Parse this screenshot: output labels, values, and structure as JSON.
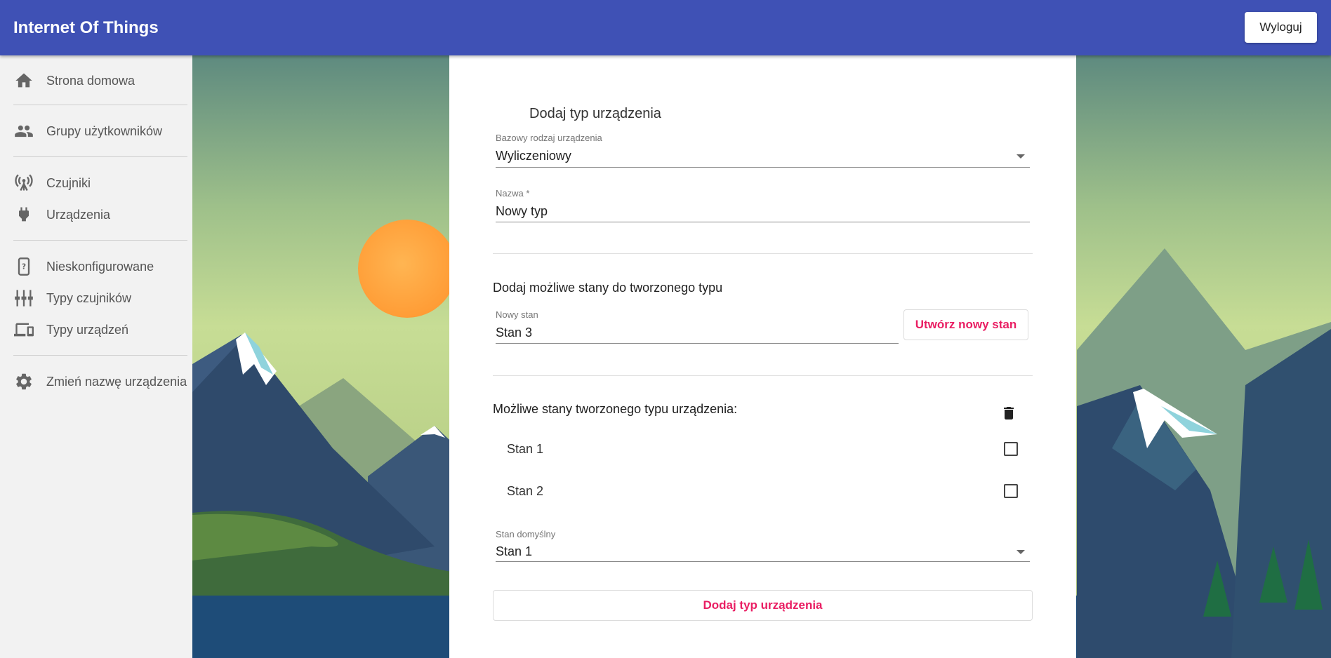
{
  "header": {
    "title": "Internet Of Things",
    "logout_label": "Wyloguj"
  },
  "sidebar": {
    "items": [
      {
        "label": "Strona domowa",
        "icon": "home-icon"
      },
      {
        "label": "Grupy użytkowników",
        "icon": "people-icon"
      },
      {
        "label": "Czujniki",
        "icon": "antenna-icon"
      },
      {
        "label": "Urządzenia",
        "icon": "plug-icon"
      },
      {
        "label": "Nieskonfigurowane",
        "icon": "unknown-device-icon"
      },
      {
        "label": "Typy czujników",
        "icon": "sliders-icon"
      },
      {
        "label": "Typy urządzeń",
        "icon": "devices-icon"
      },
      {
        "label": "Zmień nazwę urządzenia",
        "icon": "gear-icon"
      }
    ]
  },
  "form": {
    "title": "Dodaj typ urządzenia",
    "base_type": {
      "label": "Bazowy rodzaj urządzenia",
      "value": "Wyliczeniowy"
    },
    "name": {
      "label": "Nazwa *",
      "value": "Nowy typ"
    },
    "states_heading": "Dodaj możliwe stany do tworzonego typu",
    "new_state": {
      "label": "Nowy stan",
      "value": "Stan 3"
    },
    "create_state_label": "Utwórz nowy stan",
    "states_list_heading": "Możliwe stany tworzonego typu urządzenia:",
    "states": [
      {
        "label": "Stan 1",
        "checked": false
      },
      {
        "label": "Stan 2",
        "checked": false
      }
    ],
    "default_state": {
      "label": "Stan domyślny",
      "value": "Stan 1"
    },
    "submit_label": "Dodaj typ urządzenia"
  },
  "colors": {
    "primary": "#3f51b5",
    "accent": "#e91e63",
    "sidebar_bg": "#f2f2f2",
    "sun": "#ffa040"
  }
}
